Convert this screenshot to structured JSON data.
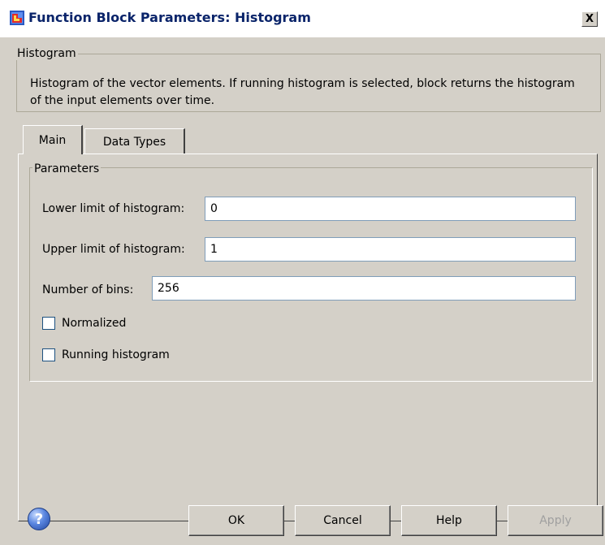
{
  "window": {
    "title": "Function Block Parameters: Histogram",
    "close_label": "X"
  },
  "description": {
    "legend": "Histogram",
    "text": "Histogram of the vector elements.  If running histogram is selected, block returns the histogram of the input elements over time."
  },
  "tabs": [
    {
      "label": "Main",
      "active": true
    },
    {
      "label": "Data Types",
      "active": false
    }
  ],
  "parameters": {
    "legend": "Parameters",
    "lower_limit": {
      "label": "Lower limit of histogram:",
      "value": "0"
    },
    "upper_limit": {
      "label": "Upper limit of histogram:",
      "value": "1"
    },
    "num_bins": {
      "label": "Number of bins:",
      "value": "256"
    },
    "normalized": {
      "label": "Normalized",
      "checked": false
    },
    "running": {
      "label": "Running histogram",
      "checked": false
    }
  },
  "buttons": {
    "help_icon": "?",
    "ok": "OK",
    "cancel": "Cancel",
    "help": "Help",
    "apply": "Apply"
  },
  "colors": {
    "dialog_bg": "#d4d0c8",
    "title_text": "#0a246a",
    "disabled_text": "#a0a0a0"
  },
  "icons": [
    "simulink-block-icon",
    "close-icon",
    "help-icon"
  ]
}
